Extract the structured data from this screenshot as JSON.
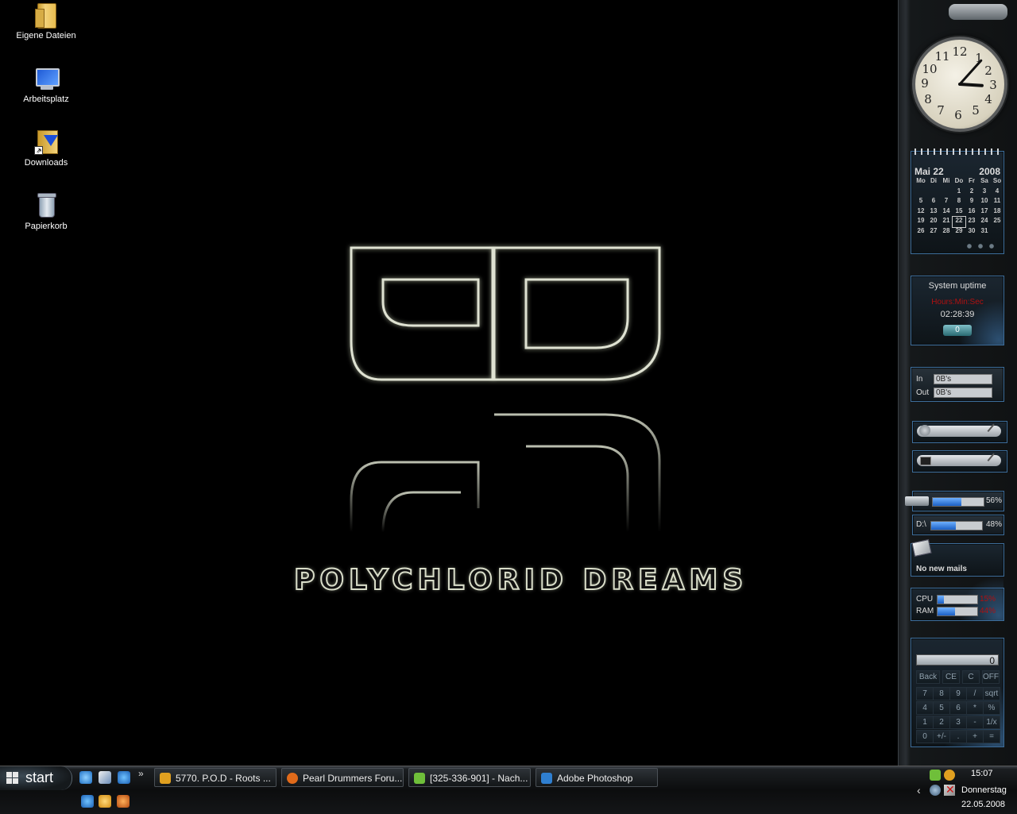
{
  "desktop": {
    "icons": [
      {
        "label": "Eigene Dateien",
        "icon": "folder-icon"
      },
      {
        "label": "Arbeitsplatz",
        "icon": "computer-icon"
      },
      {
        "label": "Downloads",
        "icon": "downloads-folder-icon"
      },
      {
        "label": "Papierkorb",
        "icon": "recycle-bin-icon"
      }
    ],
    "wallpaper_text": "POLYCHLORID DREAMS"
  },
  "sidebar": {
    "clock": {
      "hour": 3,
      "minute": 7,
      "numbers": [
        "12",
        "1",
        "2",
        "3",
        "4",
        "5",
        "6",
        "7",
        "8",
        "9",
        "10",
        "11"
      ]
    },
    "calendar": {
      "month_day": "Mai 22",
      "year": "2008",
      "weekdays": [
        "Mo",
        "Di",
        "Mi",
        "Do",
        "Fr",
        "Sa",
        "So"
      ],
      "weeks": [
        [
          "",
          "",
          "",
          "1",
          "2",
          "3",
          "4"
        ],
        [
          "5",
          "6",
          "7",
          "8",
          "9",
          "10",
          "11"
        ],
        [
          "12",
          "13",
          "14",
          "15",
          "16",
          "17",
          "18"
        ],
        [
          "19",
          "20",
          "21",
          "22",
          "23",
          "24",
          "25"
        ],
        [
          "26",
          "27",
          "28",
          "29",
          "30",
          "31",
          ""
        ]
      ],
      "today": "22"
    },
    "uptime": {
      "title": "System uptime",
      "label": "Hours:Min:Sec",
      "value": "02:28:39",
      "reset": "0"
    },
    "network": {
      "in_label": "In",
      "in_value": "0B's",
      "out_label": "Out",
      "out_value": "0B's"
    },
    "drives": [
      {
        "label": "",
        "percent_text": "56%",
        "percent": 0.56
      },
      {
        "label": "D:\\",
        "percent_text": "48%",
        "percent": 0.48
      }
    ],
    "mail": {
      "text": "No new mails"
    },
    "cpu_ram": {
      "cpu_label": "CPU",
      "cpu_text": "15%",
      "cpu": 0.15,
      "ram_label": "RAM",
      "ram_text": "44%",
      "ram": 0.44
    },
    "calculator": {
      "display": "0",
      "top_buttons": [
        "Back",
        "CE",
        "C",
        "OFF"
      ],
      "rows": [
        [
          "7",
          "8",
          "9",
          "/",
          "sqrt"
        ],
        [
          "4",
          "5",
          "6",
          "*",
          "%"
        ],
        [
          "1",
          "2",
          "3",
          "-",
          "1/x"
        ],
        [
          "0",
          "+/-",
          ".",
          "+",
          "="
        ]
      ]
    }
  },
  "taskbar": {
    "start_label": "start",
    "tasks": [
      {
        "label": "5770. P.O.D - Roots ...",
        "icon": "winamp-icon",
        "color": "#e0a020"
      },
      {
        "label": "Pearl Drummers Foru...",
        "icon": "firefox-icon",
        "color": "#e06a1a"
      },
      {
        "label": "[325-336-901] - Nach...",
        "icon": "icq-icon",
        "color": "#6fbf3a"
      },
      {
        "label": "Adobe Photoshop",
        "icon": "photoshop-icon",
        "color": "#2f7fd0"
      }
    ],
    "chevron": "»",
    "tray": {
      "time": "15:07",
      "day": "Donnerstag",
      "date": "22.05.2008",
      "arrow": "‹"
    }
  }
}
